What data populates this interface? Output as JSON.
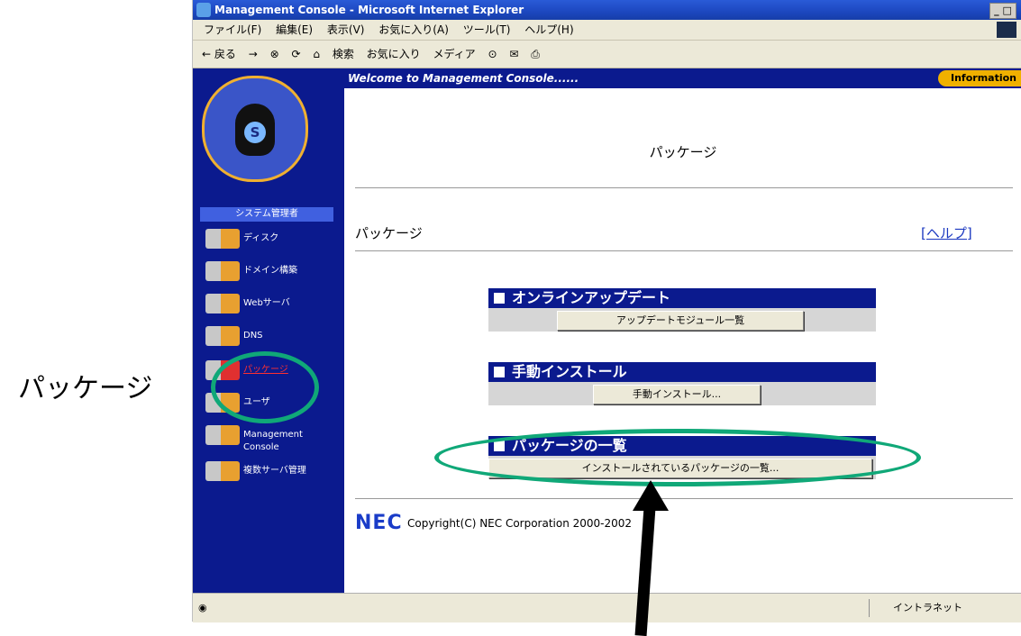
{
  "window": {
    "title": "Management Console - Microsoft Internet Explorer",
    "controls": "_ □ ×"
  },
  "menubar": [
    "ファイル(F)",
    "編集(E)",
    "表示(V)",
    "お気に入り(A)",
    "ツール(T)",
    "ヘルプ(H)"
  ],
  "toolbar": [
    "← 戻る",
    "→",
    "⊗",
    "⟳",
    "⌂",
    "検索",
    "お気に入り",
    "メディア",
    "⊙",
    "✉",
    "⎙"
  ],
  "sidebar": {
    "logo_letter": "S",
    "section": "システム管理者",
    "items": [
      {
        "label": "ディスク"
      },
      {
        "label": "ドメイン構築"
      },
      {
        "label": "Webサーバ"
      },
      {
        "label": "DNS"
      },
      {
        "label": "パッケージ"
      },
      {
        "label": "ユーザ"
      },
      {
        "label": "Management Console"
      },
      {
        "label": "複数サーバ管理"
      }
    ]
  },
  "banner": {
    "welcome": "Welcome to Management Console......",
    "info": "Information"
  },
  "main": {
    "page_title": "パッケージ",
    "subheading": "パッケージ",
    "help_link": "[ヘルプ]",
    "sections": [
      {
        "title": "オンラインアップデート",
        "button": "アップデートモジュール一覧"
      },
      {
        "title": "手動インストール",
        "button": "手動インストール..."
      },
      {
        "title": "パッケージの一覧",
        "button": "インストールされているパッケージの一覧..."
      }
    ],
    "nec": "NEC",
    "copyright": "Copyright(C) NEC Corporation 2000-2002"
  },
  "statusbar": {
    "zone": "イントラネット"
  },
  "annotation": {
    "label": "パッケージ"
  },
  "colors": {
    "sidebar": "#0b1a8e",
    "accent": "#f0b000",
    "annotation": "#10a878"
  }
}
